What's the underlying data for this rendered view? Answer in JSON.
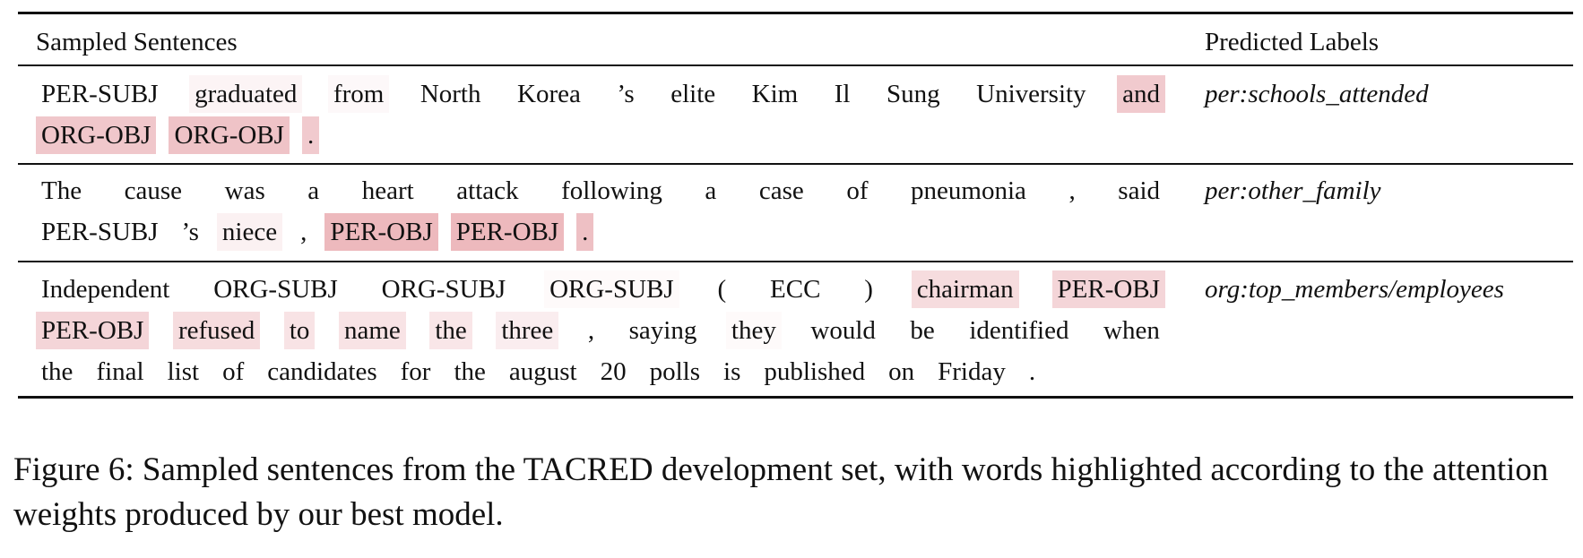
{
  "table": {
    "headers": {
      "sentences": "Sampled Sentences",
      "labels": "Predicted Labels"
    },
    "rows": [
      {
        "label": "per:schools_attended",
        "lines": [
          [
            {
              "t": "PER-SUBJ",
              "w": 0
            },
            {
              "t": "graduated",
              "w": 0.06
            },
            {
              "t": "from",
              "w": 0.04
            },
            {
              "t": "North",
              "w": 0
            },
            {
              "t": "Korea",
              "w": 0
            },
            {
              "t": "’s",
              "w": 0
            },
            {
              "t": "elite",
              "w": 0
            },
            {
              "t": "Kim",
              "w": 0
            },
            {
              "t": "Il",
              "w": 0
            },
            {
              "t": "Sung",
              "w": 0
            },
            {
              "t": "University",
              "w": 0
            },
            {
              "t": "and",
              "w": 0.3
            }
          ],
          [
            {
              "t": "ORG-OBJ",
              "w": 0.32
            },
            {
              "t": "ORG-OBJ",
              "w": 0.34
            },
            {
              "t": ".",
              "w": 0.3
            }
          ]
        ]
      },
      {
        "label": "per:other_family",
        "lines": [
          [
            {
              "t": "The",
              "w": 0
            },
            {
              "t": "cause",
              "w": 0
            },
            {
              "t": "was",
              "w": 0
            },
            {
              "t": "a",
              "w": 0
            },
            {
              "t": "heart",
              "w": 0
            },
            {
              "t": "attack",
              "w": 0
            },
            {
              "t": "following",
              "w": 0
            },
            {
              "t": "a",
              "w": 0
            },
            {
              "t": "case",
              "w": 0
            },
            {
              "t": "of",
              "w": 0
            },
            {
              "t": "pneumonia",
              "w": 0
            },
            {
              "t": ",",
              "w": 0
            },
            {
              "t": "said",
              "w": 0
            }
          ],
          [
            {
              "t": "PER-SUBJ",
              "w": 0
            },
            {
              "t": "’s",
              "w": 0
            },
            {
              "t": "niece",
              "w": 0.08
            },
            {
              "t": ",",
              "w": 0
            },
            {
              "t": "PER-OBJ",
              "w": 0.4
            },
            {
              "t": "PER-OBJ",
              "w": 0.4
            },
            {
              "t": ".",
              "w": 0.36
            }
          ]
        ]
      },
      {
        "label": "org:top_members/employees",
        "lines": [
          [
            {
              "t": "Independent",
              "w": 0
            },
            {
              "t": "ORG-SUBJ",
              "w": 0
            },
            {
              "t": "ORG-SUBJ",
              "w": 0
            },
            {
              "t": "ORG-SUBJ",
              "w": 0.03
            },
            {
              "t": "(",
              "w": 0
            },
            {
              "t": "ECC",
              "w": 0
            },
            {
              "t": ")",
              "w": 0
            },
            {
              "t": "chairman",
              "w": 0.2
            },
            {
              "t": "PER-OBJ",
              "w": 0.24
            }
          ],
          [
            {
              "t": "PER-OBJ",
              "w": 0.24
            },
            {
              "t": "refused",
              "w": 0.2
            },
            {
              "t": "to",
              "w": 0.16
            },
            {
              "t": "name",
              "w": 0.16
            },
            {
              "t": "the",
              "w": 0.14
            },
            {
              "t": "three",
              "w": 0.1
            },
            {
              "t": ",",
              "w": 0
            },
            {
              "t": "saying",
              "w": 0
            },
            {
              "t": "they",
              "w": 0.03
            },
            {
              "t": "would",
              "w": 0
            },
            {
              "t": "be",
              "w": 0
            },
            {
              "t": "identified",
              "w": 0
            },
            {
              "t": "when",
              "w": 0
            }
          ],
          [
            {
              "t": "the",
              "w": 0
            },
            {
              "t": "final",
              "w": 0
            },
            {
              "t": "list",
              "w": 0
            },
            {
              "t": "of",
              "w": 0
            },
            {
              "t": "candidates",
              "w": 0
            },
            {
              "t": "for",
              "w": 0
            },
            {
              "t": "the",
              "w": 0
            },
            {
              "t": "august",
              "w": 0
            },
            {
              "t": "20",
              "w": 0
            },
            {
              "t": "polls",
              "w": 0
            },
            {
              "t": "is",
              "w": 0
            },
            {
              "t": "published",
              "w": 0
            },
            {
              "t": "on",
              "w": 0
            },
            {
              "t": "Friday",
              "w": 0
            },
            {
              "t": ".",
              "w": 0
            }
          ]
        ]
      }
    ]
  },
  "highlight_color": "#e8a7ad",
  "caption": "Figure 6: Sampled sentences from the TACRED development set, with words highlighted according to the attention weights produced by our best model."
}
